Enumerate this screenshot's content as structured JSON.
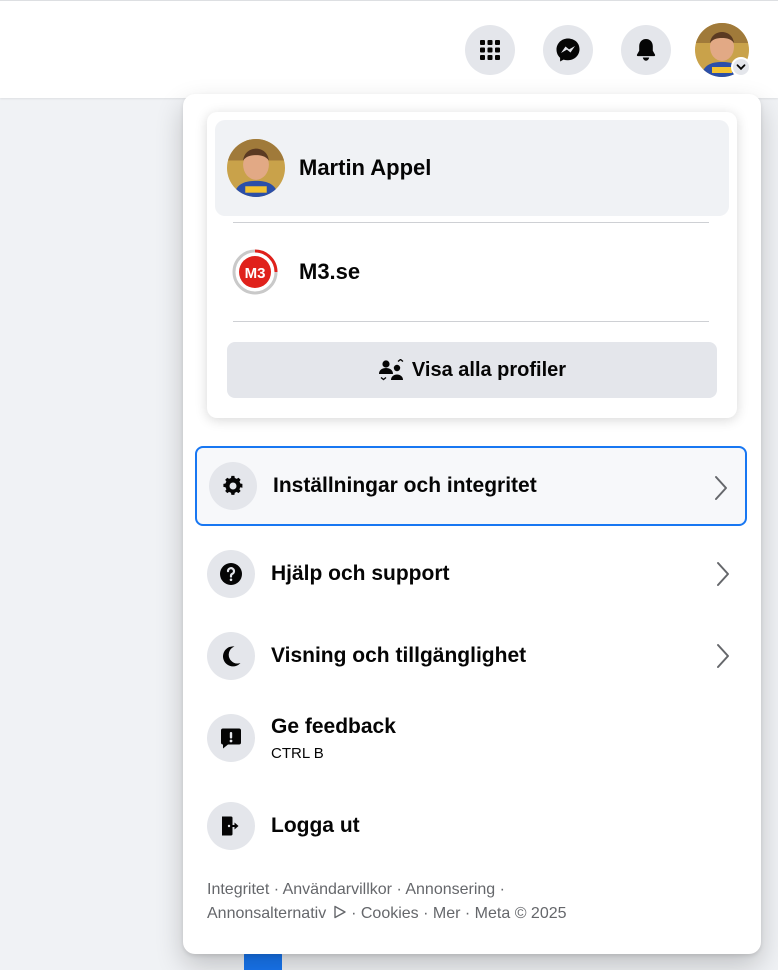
{
  "topbar": {
    "buttons": [
      {
        "icon": "menu-grid-icon"
      },
      {
        "icon": "messenger-icon"
      },
      {
        "icon": "bell-icon"
      }
    ]
  },
  "profiles": {
    "active_name": "Martin Appel",
    "page_name": "M3.se",
    "page_logo_text": "M3",
    "view_all_label": "Visa alla profiler"
  },
  "menu": {
    "items": [
      {
        "label": "Inställningar och integritet",
        "icon": "gear-icon",
        "chevron": true
      },
      {
        "label": "Hjälp och support",
        "icon": "question-icon",
        "chevron": true
      },
      {
        "label": "Visning och tillgänglighet",
        "icon": "moon-icon",
        "chevron": true
      },
      {
        "label": "Ge feedback",
        "sub": "CTRL B",
        "icon": "feedback-icon",
        "chevron": false
      },
      {
        "label": "Logga ut",
        "icon": "logout-icon",
        "chevron": false
      }
    ]
  },
  "footer": {
    "links": [
      "Integritet",
      "Användarvillkor",
      "Annonsering",
      "Annonsalternativ",
      "Cookies",
      "Mer",
      "Meta © 2025"
    ],
    "separator": " · "
  },
  "colors": {
    "accent": "#1877f2",
    "icon_bg": "#e4e6eb",
    "m3_red": "#e0211b"
  }
}
